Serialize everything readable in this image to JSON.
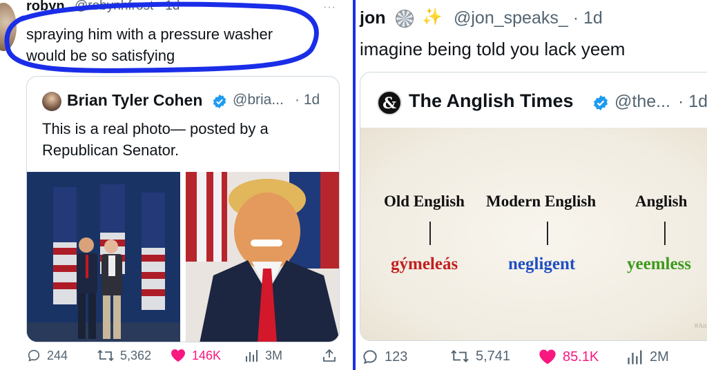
{
  "left_tweet": {
    "author_name": "robyn",
    "author_handle_time": "@robynhfrost · 1d",
    "more_label": "···",
    "text": "spraying him with a pressure washer would be so satisfying",
    "quote": {
      "author_name": "Brian Tyler Cohen",
      "author_handle": "@bria...",
      "time": "· 1d",
      "text": "This is a real photo— posted by a Republican Senator."
    },
    "actions": {
      "replies": "244",
      "reposts": "5,362",
      "likes": "146K",
      "views": "3M"
    }
  },
  "right_tweet": {
    "author_name": "jon",
    "author_emoji": "✨",
    "author_handle_time": "@jon_speaks_ · 1d",
    "text": "imagine being told you lack yeem",
    "quote": {
      "author_name": "The Anglish Times",
      "author_handle": "@the...",
      "time": "· 1d",
      "avatar_glyph": "&",
      "image": {
        "columns": [
          {
            "title": "Old English",
            "word": "gýmeleás",
            "color": "#c0201f"
          },
          {
            "title": "Modern English",
            "word": "negligent",
            "color": "#1f4fc0"
          },
          {
            "title": "Anglish",
            "word": "yeemless",
            "color": "#3d9a1c"
          }
        ],
        "watermark": "#An"
      }
    },
    "actions": {
      "replies": "123",
      "reposts": "5,741",
      "likes": "85.1K",
      "views": "2M"
    }
  },
  "colors": {
    "divider": "#1a2ee8",
    "highlight_circle": "#1a2ee8",
    "verified": "#1d9bf0",
    "like": "#f91880",
    "muted": "#536471"
  }
}
